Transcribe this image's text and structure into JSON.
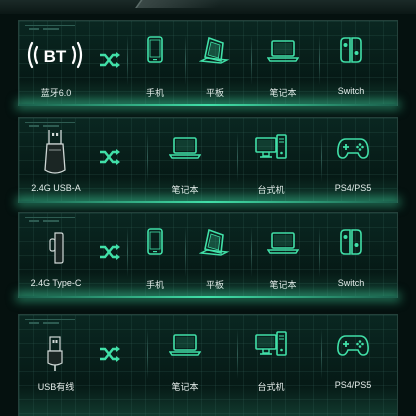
{
  "accent_color": "#41e0a8",
  "cards": [
    {
      "source": {
        "icon": "bluetooth-5-icon",
        "text": "BT",
        "label": "蓝牙6.0"
      },
      "devices": [
        {
          "icon": "phone-icon",
          "label": "手机"
        },
        {
          "icon": "tablet-icon",
          "label": "平板"
        },
        {
          "icon": "laptop-icon",
          "label": "笔记本"
        },
        {
          "icon": "switch-console-icon",
          "label": "Switch"
        }
      ]
    },
    {
      "source": {
        "icon": "usb-a-receiver-icon",
        "label": "2.4G USB-A"
      },
      "devices": [
        {
          "icon": "laptop-icon",
          "label": "笔记本"
        },
        {
          "icon": "desktop-pc-icon",
          "label": "台式机"
        },
        {
          "icon": "gamepad-icon",
          "label": "PS4/PS5"
        }
      ]
    },
    {
      "source": {
        "icon": "type-c-receiver-icon",
        "label": "2.4G Type-C"
      },
      "devices": [
        {
          "icon": "phone-icon",
          "label": "手机"
        },
        {
          "icon": "tablet-icon",
          "label": "平板"
        },
        {
          "icon": "laptop-icon",
          "label": "笔记本"
        },
        {
          "icon": "switch-console-icon",
          "label": "Switch"
        }
      ]
    },
    {
      "source": {
        "icon": "usb-cable-icon",
        "label": "USB有线"
      },
      "devices": [
        {
          "icon": "laptop-icon",
          "label": "笔记本"
        },
        {
          "icon": "desktop-pc-icon",
          "label": "台式机"
        },
        {
          "icon": "gamepad-icon",
          "label": "PS4/PS5"
        }
      ]
    }
  ]
}
